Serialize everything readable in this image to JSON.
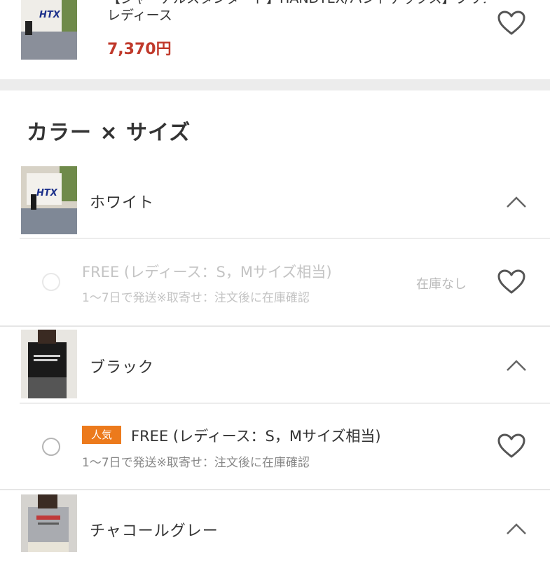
{
  "top_product": {
    "title": "【ジャーナルスタンダード】HANDTEX/ハンドテックス】プリントロゴT",
    "subtitle": "レディース",
    "price": "7,370円"
  },
  "section_title": "カラー × サイズ",
  "colors": [
    {
      "name": "ホワイト",
      "variant": {
        "size": "FREE (レディース：S，Mサイズ相当)",
        "shipping": "1〜7日で発送※取寄せ：注文後に在庫確認",
        "stock": "在庫なし"
      }
    },
    {
      "name": "ブラック",
      "variant": {
        "badge": "人気",
        "size": "FREE (レディース：S，Mサイズ相当)",
        "shipping": "1〜7日で発送※取寄せ：注文後に在庫確認"
      }
    },
    {
      "name": "チャコールグレー"
    }
  ],
  "colors_theme": {
    "price": "#c0392b",
    "badge": "#ec7a1c",
    "divider": "#ececec"
  }
}
